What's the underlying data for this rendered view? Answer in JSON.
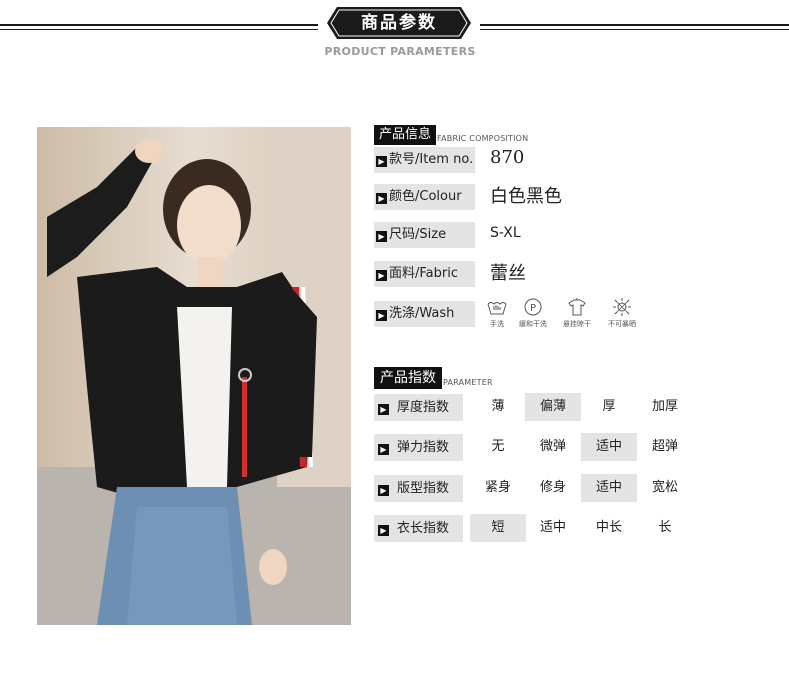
{
  "header": {
    "title": "商品参数",
    "subtitle": "PRODUCT PARAMETERS"
  },
  "fabric_section": {
    "tag": "产品信息",
    "sub": "FABRIC COMPOSITION"
  },
  "info": {
    "item_no": {
      "label": "款号/Item no.",
      "value": "870"
    },
    "colour": {
      "label": "颜色/Colour",
      "value": "白色黑色"
    },
    "size": {
      "label": "尺码/Size",
      "value": "S-XL"
    },
    "fabric": {
      "label": "面料/Fabric",
      "value": "蕾丝"
    },
    "wash": {
      "label": "洗涤/Wash"
    }
  },
  "wash_icons": [
    {
      "icon": "hand-wash-icon",
      "label": "手洗"
    },
    {
      "icon": "gentle-dry-clean-icon",
      "label": "缓和干洗"
    },
    {
      "icon": "hang-dry-icon",
      "label": "悬挂晾干"
    },
    {
      "icon": "no-sun-icon",
      "label": "不可暴晒"
    }
  ],
  "param_section": {
    "tag": "产品指数",
    "sub": "PARAMETER"
  },
  "params": [
    {
      "label": "厚度指数",
      "options": [
        "薄",
        "偏薄",
        "厚",
        "加厚"
      ],
      "selected": 1
    },
    {
      "label": "弹力指数",
      "options": [
        "无",
        "微弹",
        "适中",
        "超弹"
      ],
      "selected": 2
    },
    {
      "label": "版型指数",
      "options": [
        "紧身",
        "修身",
        "适中",
        "宽松"
      ],
      "selected": 2
    },
    {
      "label": "衣长指数",
      "options": [
        "短",
        "适中",
        "中长",
        "长"
      ],
      "selected": 0
    }
  ],
  "colors": {
    "accent": "#111111",
    "highlight": "#e4e4e4",
    "subtitle_gray": "#9a9a9a"
  }
}
